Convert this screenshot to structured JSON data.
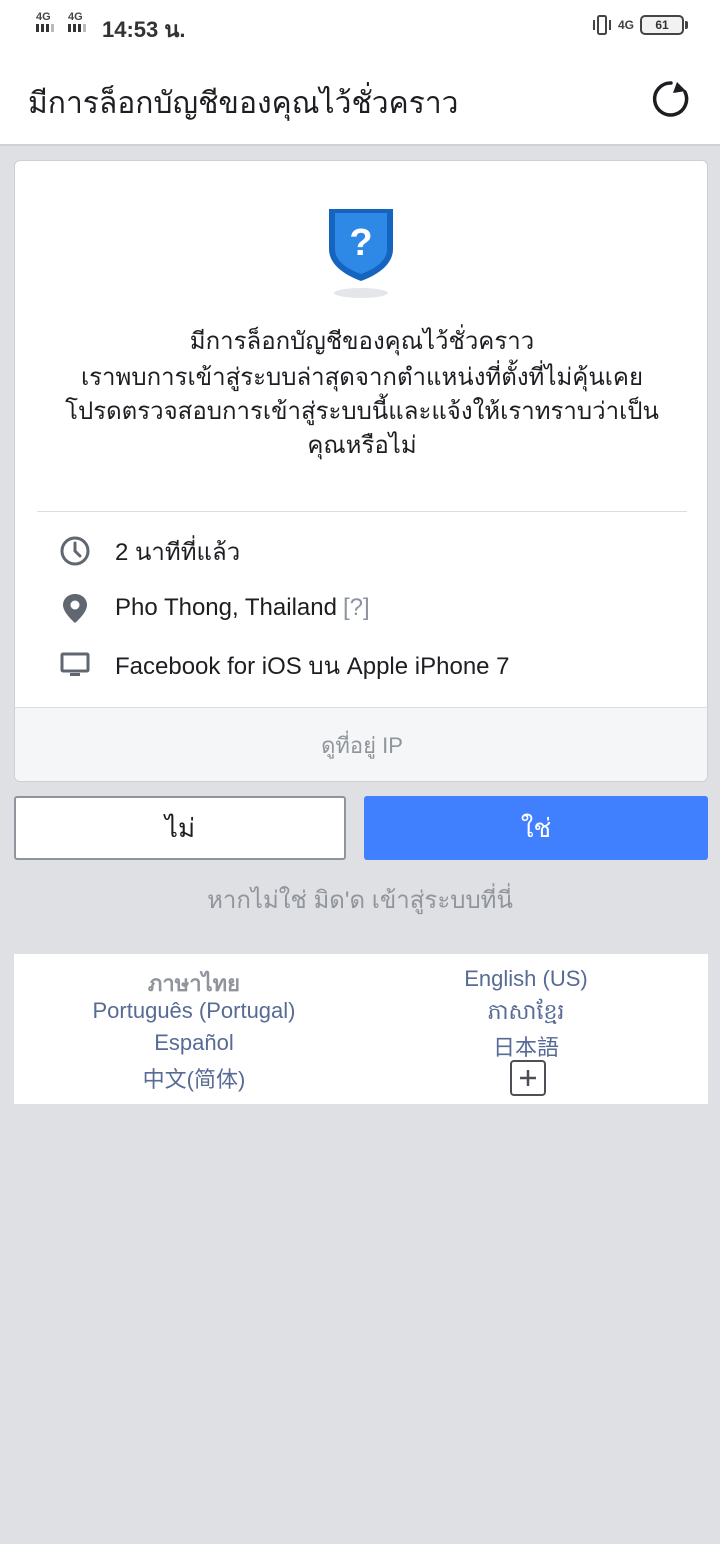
{
  "status_bar": {
    "network1": "4G",
    "network2": "4G",
    "time": "14:53 น.",
    "network3": "4G",
    "battery": "61"
  },
  "header": {
    "title": "มีการล็อกบัญชีของคุณไว้ชั่วคราว"
  },
  "card": {
    "heading": "มีการล็อกบัญชีของคุณไว้ชั่วคราว",
    "body_line1": "เราพบการเข้าสู่ระบบล่าสุดจากตำแหน่งที่ตั้งที่ไม่คุ้นเคย",
    "body_line2": "โปรดตรวจสอบการเข้าสู่ระบบนี้และแจ้งให้เราทราบว่าเป็น",
    "body_line3": "คุณหรือไม่",
    "time_ago": "2 นาทีที่แล้ว",
    "location": "Pho Thong, Thailand",
    "location_help": "[?]",
    "device": "Facebook for iOS บน Apple iPhone 7",
    "ip_link": "ดูที่อยู่ IP"
  },
  "actions": {
    "no_label": "ไม่",
    "yes_label": "ใช่",
    "not_me_text": "หากไม่ใช่ มิด'ด เข้าสู่ระบบที่นี่"
  },
  "languages": {
    "current": "ภาษาไทย",
    "items": [
      "English (US)",
      "Português (Portugal)",
      "ភាសាខ្មែរ",
      "Español",
      "日本語",
      "中文(简体)"
    ]
  },
  "colors": {
    "primary_button": "#4080ff",
    "link": "#576b95",
    "shield": "#1565c0"
  }
}
